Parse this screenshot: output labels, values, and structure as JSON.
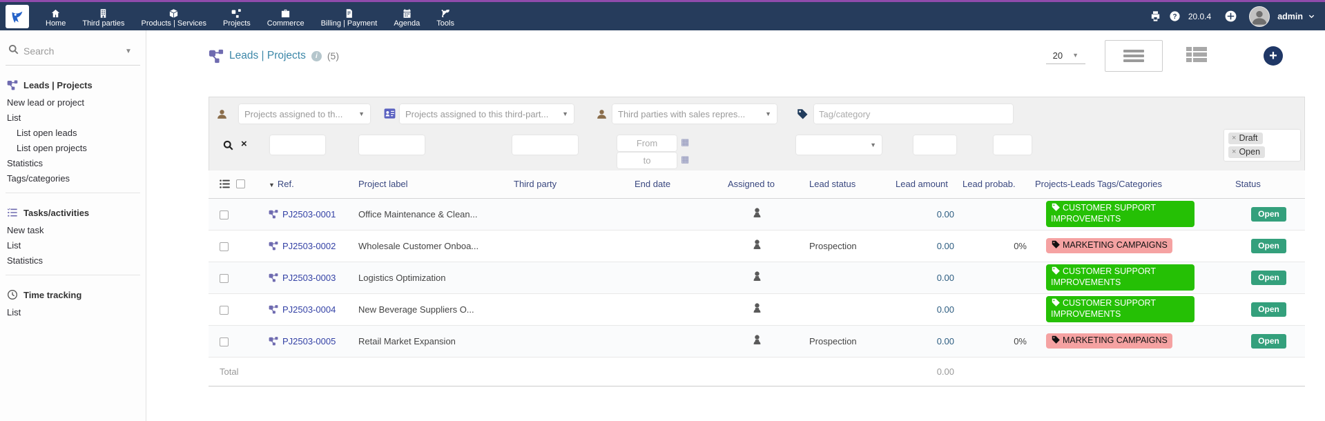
{
  "topbar": {
    "version": "20.0.4",
    "user": "admin",
    "menu": [
      {
        "label": "Home",
        "icon": "home-icon"
      },
      {
        "label": "Third parties",
        "icon": "building-icon"
      },
      {
        "label": "Products | Services",
        "icon": "box-icon"
      },
      {
        "label": "Projects",
        "icon": "project-icon"
      },
      {
        "label": "Commerce",
        "icon": "briefcase-icon"
      },
      {
        "label": "Billing | Payment",
        "icon": "invoice-icon"
      },
      {
        "label": "Agenda",
        "icon": "calendar-icon"
      },
      {
        "label": "Tools",
        "icon": "tools-icon"
      }
    ]
  },
  "sidebar": {
    "search_placeholder": "Search",
    "sections": [
      {
        "title": "Leads | Projects",
        "icon": "project-icon",
        "items": [
          {
            "label": "New lead or project",
            "indent": false
          },
          {
            "label": "List",
            "indent": false
          },
          {
            "label": "List open leads",
            "indent": true
          },
          {
            "label": "List open projects",
            "indent": true
          },
          {
            "label": "Statistics",
            "indent": false
          },
          {
            "label": "Tags/categories",
            "indent": false
          }
        ]
      },
      {
        "title": "Tasks/activities",
        "icon": "tasks-icon",
        "items": [
          {
            "label": "New task",
            "indent": false
          },
          {
            "label": "List",
            "indent": false
          },
          {
            "label": "Statistics",
            "indent": false
          }
        ]
      },
      {
        "title": "Time tracking",
        "icon": "clock-icon",
        "items": [
          {
            "label": "List",
            "indent": false
          }
        ]
      }
    ]
  },
  "header": {
    "title": "Leads | Projects",
    "count": "(5)",
    "page_size": "20"
  },
  "filters": {
    "assigned_user_placeholder": "Projects assigned to th...",
    "assigned_third_placeholder": "Projects assigned to this third-part...",
    "sales_rep_placeholder": "Third parties with sales repres...",
    "tag_placeholder": "Tag/category",
    "date_from_placeholder": "From",
    "date_to_placeholder": "to",
    "status_chips": [
      "Draft",
      "Open"
    ]
  },
  "table": {
    "headers": [
      "Ref.",
      "Project label",
      "Third party",
      "End date",
      "Assigned to",
      "Lead status",
      "Lead amount",
      "Lead probab.",
      "Projects-Leads Tags/Categories",
      "Status"
    ],
    "rows": [
      {
        "ref": "PJ2503-0001",
        "label": "Office Maintenance & Clean...",
        "third_party": "",
        "end_date": "",
        "lead_status": "",
        "amount": "0.00",
        "probab": "",
        "tags": [
          {
            "label": "CUSTOMER SUPPORT IMPROVEMENTS",
            "color": "green"
          }
        ],
        "status": "Open"
      },
      {
        "ref": "PJ2503-0002",
        "label": "Wholesale Customer Onboa...",
        "third_party": "",
        "end_date": "",
        "lead_status": "Prospection",
        "amount": "0.00",
        "probab": "0%",
        "tags": [
          {
            "label": "MARKETING CAMPAIGNS",
            "color": "pink"
          }
        ],
        "status": "Open"
      },
      {
        "ref": "PJ2503-0003",
        "label": "Logistics Optimization",
        "third_party": "",
        "end_date": "",
        "lead_status": "",
        "amount": "0.00",
        "probab": "",
        "tags": [
          {
            "label": "CUSTOMER SUPPORT IMPROVEMENTS",
            "color": "green"
          }
        ],
        "status": "Open"
      },
      {
        "ref": "PJ2503-0004",
        "label": "New Beverage Suppliers O...",
        "third_party": "",
        "end_date": "",
        "lead_status": "",
        "amount": "0.00",
        "probab": "",
        "tags": [
          {
            "label": "CUSTOMER SUPPORT IMPROVEMENTS",
            "color": "green"
          }
        ],
        "status": "Open"
      },
      {
        "ref": "PJ2503-0005",
        "label": "Retail Market Expansion",
        "third_party": "",
        "end_date": "",
        "lead_status": "Prospection",
        "amount": "0.00",
        "probab": "0%",
        "tags": [
          {
            "label": "MARKETING CAMPAIGNS",
            "color": "pink"
          }
        ],
        "status": "Open"
      }
    ],
    "total_label": "Total",
    "total_amount": "0.00"
  },
  "colors": {
    "topbar_bg": "#263c5c",
    "topbar_line": "#8f4bab",
    "title": "#3c87a8",
    "link": "#3341a5",
    "amount": "#2c5c80",
    "tag_green": "#25c005",
    "tag_pink": "#f5a2a2",
    "status_open": "#34a07c",
    "add_button": "#1f3766"
  }
}
